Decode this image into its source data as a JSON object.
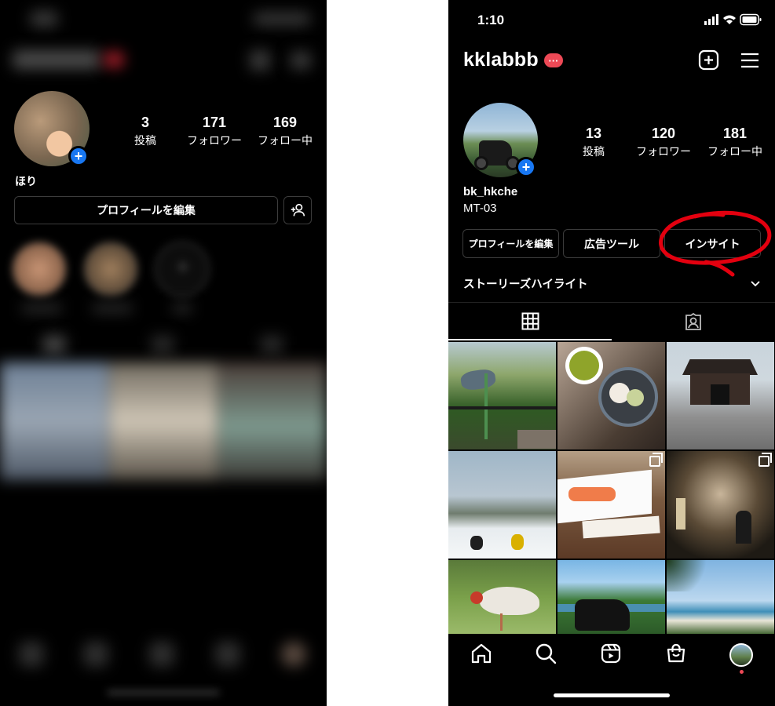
{
  "left": {
    "profile_name": "ほり",
    "stats": [
      {
        "value": "3",
        "label": "投稿"
      },
      {
        "value": "171",
        "label": "フォロワー"
      },
      {
        "value": "169",
        "label": "フォロー中"
      }
    ],
    "edit_profile_label": "プロフィールを編集"
  },
  "right": {
    "time": "1:10",
    "username": "kklabbb",
    "menu_badge": "···",
    "stats": [
      {
        "value": "13",
        "label": "投稿"
      },
      {
        "value": "120",
        "label": "フォロワー"
      },
      {
        "value": "181",
        "label": "フォロー中"
      }
    ],
    "display_name": "bk_hkche",
    "bio": "MT-03",
    "buttons": {
      "edit_profile": "プロフィールを編集",
      "ads_tools": "広告ツール",
      "insights": "インサイト"
    },
    "story_highlights_label": "ストーリーズハイライト",
    "annotation_color": "#e3000f",
    "accent": "#1877f2",
    "notification_dot": "#ed4956"
  }
}
